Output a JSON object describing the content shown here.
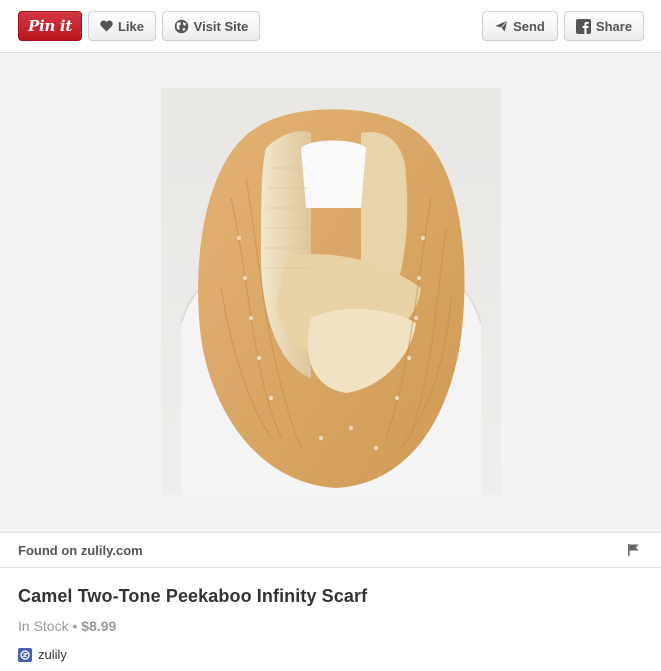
{
  "toolbar": {
    "pinit_label": "Pin it",
    "like_label": "Like",
    "visit_label": "Visit Site",
    "send_label": "Send",
    "share_label": "Share"
  },
  "found": {
    "text": "Found on zulily.com"
  },
  "product": {
    "title": "Camel Two-Tone Peekaboo Infinity Scarf",
    "stock": "In Stock",
    "separator": " • ",
    "price": "$8.99"
  },
  "store": {
    "name": "zulily"
  },
  "colors": {
    "pinit_red": "#c8232c",
    "scarf_camel": "#d9a862",
    "scarf_cream": "#ead9b8"
  }
}
